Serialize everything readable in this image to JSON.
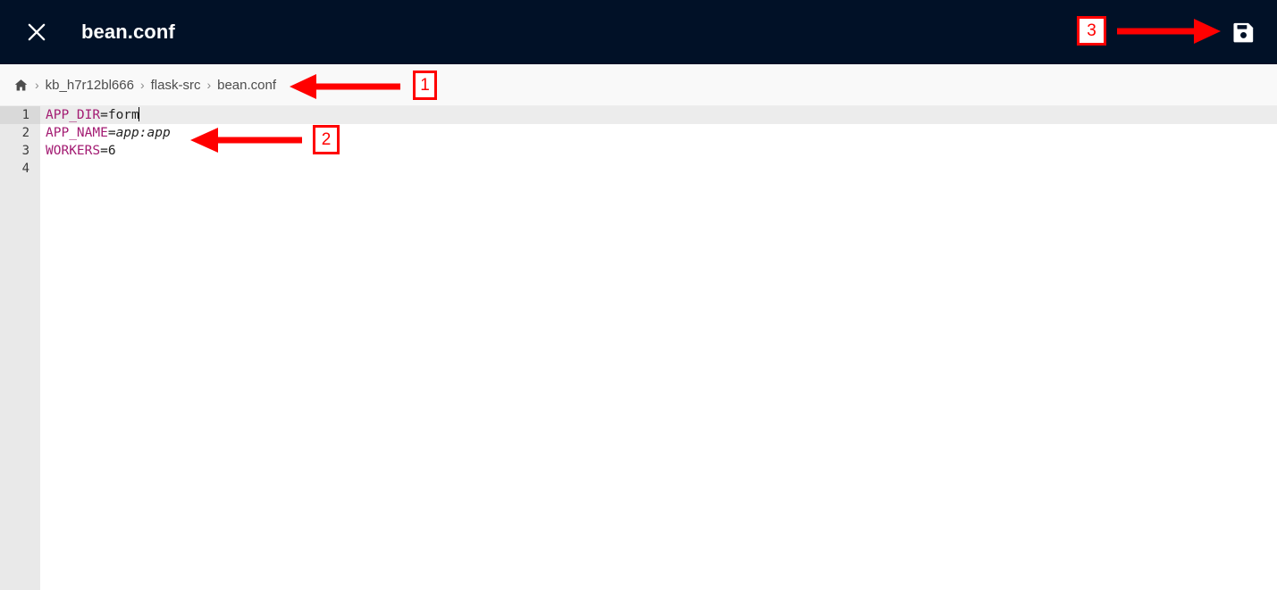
{
  "header": {
    "title": "bean.conf",
    "close_icon": "close-icon",
    "save_icon": "save-floppy-icon"
  },
  "breadcrumb": {
    "home_icon": "home-icon",
    "separator": "›",
    "items": [
      {
        "label": "kb_h7r12bl666"
      },
      {
        "label": "flask-src"
      },
      {
        "label": "bean.conf"
      }
    ]
  },
  "editor": {
    "gutter_numbers": [
      "1",
      "2",
      "3",
      "4"
    ],
    "active_line": 1,
    "lines": [
      {
        "key": "APP_DIR",
        "op": "=",
        "value": "form",
        "italic": false,
        "caret": true
      },
      {
        "key": "APP_NAME",
        "op": "=",
        "value": "app:app",
        "italic": true,
        "caret": false
      },
      {
        "key": "WORKERS",
        "op": "=",
        "value": "6",
        "italic": false,
        "caret": false
      },
      {
        "key": "",
        "op": "",
        "value": "",
        "italic": false,
        "caret": false
      }
    ]
  },
  "annotations": [
    {
      "id": "1",
      "label": "1"
    },
    {
      "id": "2",
      "label": "2"
    },
    {
      "id": "3",
      "label": "3"
    }
  ],
  "colors": {
    "header_bg": "#011127",
    "breadcrumb_bg": "#f9f9f9",
    "gutter_bg": "#e9e9e9",
    "active_line_bg": "#ececec",
    "key_token": "#a31b72",
    "annotation_red": "#ff0000"
  }
}
